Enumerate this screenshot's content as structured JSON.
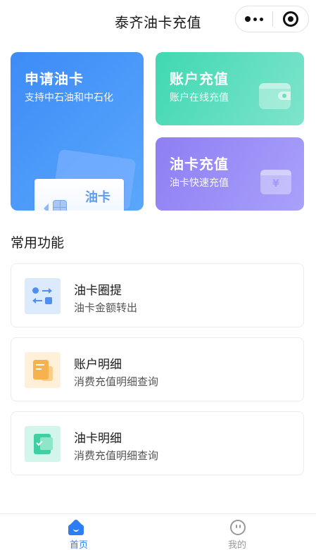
{
  "header": {
    "title": "泰齐油卡充值",
    "more_icon": "more-dots-icon",
    "close_icon": "target-close-icon"
  },
  "cards": {
    "apply": {
      "title": "申请油卡",
      "subtitle": "支持中石油和中石化",
      "card_label": "油卡",
      "color": "#3d8bf7"
    },
    "account": {
      "title": "账户充值",
      "subtitle": "账户在线充值",
      "icon": "wallet-icon",
      "color": "#3fd8b1"
    },
    "oil_recharge": {
      "title": "油卡充值",
      "subtitle": "油卡快速充值",
      "icon": "yen-card-icon",
      "yen": "¥",
      "color": "#8e7ef3"
    }
  },
  "section": {
    "title": "常用功能"
  },
  "functions": [
    {
      "title": "油卡圈提",
      "subtitle": "油卡金额转出",
      "icon": "transfer-icon"
    },
    {
      "title": "账户明细",
      "subtitle": "消费充值明细查询",
      "icon": "bill-icon"
    },
    {
      "title": "油卡明细",
      "subtitle": "消费充值明细查询",
      "icon": "oil-detail-icon"
    }
  ],
  "tabbar": {
    "active_color": "#2e7df6",
    "items": [
      {
        "label": "首页",
        "icon": "home-icon",
        "active": true
      },
      {
        "label": "我的",
        "icon": "profile-icon",
        "active": false
      }
    ]
  }
}
